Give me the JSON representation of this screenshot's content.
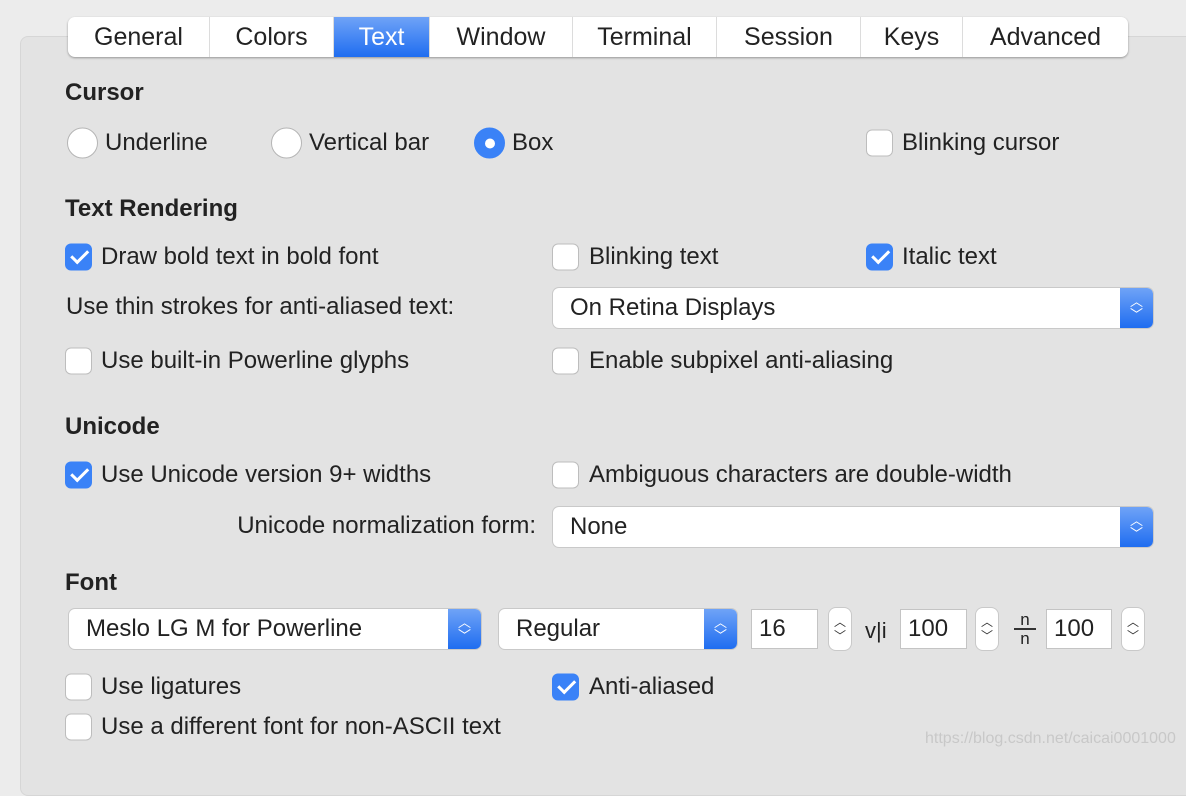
{
  "tabs": [
    "General",
    "Colors",
    "Text",
    "Window",
    "Terminal",
    "Session",
    "Keys",
    "Advanced"
  ],
  "active_tab": "Text",
  "cursor": {
    "heading": "Cursor",
    "underline": "Underline",
    "vertical_bar": "Vertical bar",
    "box": "Box",
    "selected": "Box",
    "blinking": "Blinking cursor",
    "blinking_checked": false
  },
  "rendering": {
    "heading": "Text Rendering",
    "bold": "Draw bold text in bold font",
    "bold_checked": true,
    "blinking": "Blinking text",
    "blinking_checked": false,
    "italic": "Italic text",
    "italic_checked": true,
    "thin_label": "Use thin strokes for anti-aliased text:",
    "thin_value": "On Retina Displays",
    "powerline": "Use built-in Powerline glyphs",
    "powerline_checked": false,
    "subpixel": "Enable subpixel anti-aliasing",
    "subpixel_checked": false
  },
  "unicode": {
    "heading": "Unicode",
    "widths": "Use Unicode version 9+ widths",
    "widths_checked": true,
    "ambiguous": "Ambiguous characters are double-width",
    "ambiguous_checked": false,
    "norm_label": "Unicode normalization form:",
    "norm_value": "None"
  },
  "font": {
    "heading": "Font",
    "family": "Meslo LG M for Powerline",
    "style": "Regular",
    "size": "16",
    "h_spacing_icon": "v|i",
    "h_spacing": "100",
    "v_spacing_icon": "n/n",
    "v_spacing": "100",
    "ligatures": "Use ligatures",
    "ligatures_checked": false,
    "antialiased": "Anti-aliased",
    "antialiased_checked": true,
    "non_ascii": "Use a different font for non-ASCII text",
    "non_ascii_checked": false
  },
  "watermark": "https://blog.csdn.net/caicai0001000",
  "colors": {
    "accent": "#3a82f7"
  }
}
